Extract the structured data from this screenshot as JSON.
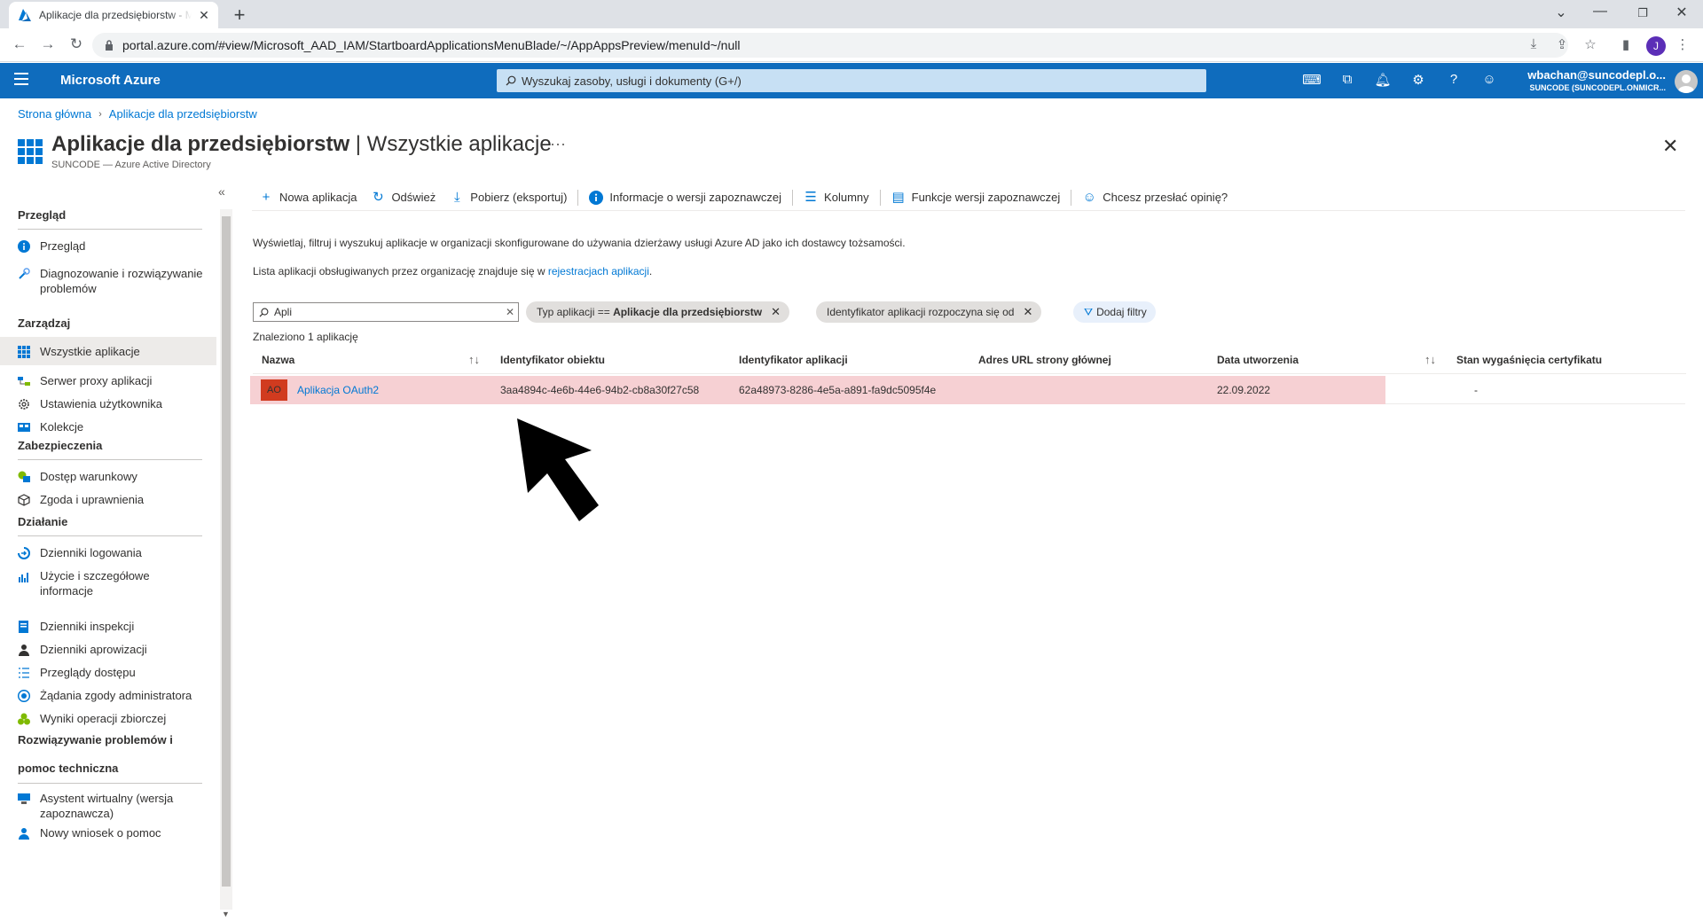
{
  "browser": {
    "tab_title": "Aplikacje dla przedsiębiorstw - Microsoft Azure",
    "url": "portal.azure.com/#view/Microsoft_AAD_IAM/StartboardApplicationsMenuBlade/~/AppAppsPreview/menuId~/null",
    "profile_initial": "J"
  },
  "azure": {
    "brand": "Microsoft Azure",
    "search_placeholder": "Wyszukaj zasoby, usługi i dokumenty (G+/)",
    "user_email": "wbachan@suncodepl.o...",
    "user_tenant": "SUNCODE (SUNCODEPL.ONMICR..."
  },
  "breadcrumb": {
    "home": "Strona główna",
    "current": "Aplikacje dla przedsiębiorstw"
  },
  "header": {
    "title_main": "Aplikacje dla przedsiębiorstw",
    "title_rest": " | Wszystkie aplikacje",
    "subtitle": "SUNCODE — Azure Active Directory",
    "more": "···"
  },
  "sidebar": {
    "sections": {
      "overview": "Przegląd",
      "manage": "Zarządzaj",
      "security": "Zabezpieczenia",
      "activity": "Działanie",
      "troubleshoot_1": "Rozwiązywanie problemów i",
      "troubleshoot_2": "pomoc techniczna"
    },
    "items": {
      "overview": "Przegląd",
      "diagnose": "Diagnozowanie i rozwiązywanie problemów",
      "all_apps": "Wszystkie aplikacje",
      "proxy": "Serwer proxy aplikacji",
      "user_settings": "Ustawienia użytkownika",
      "collections": "Kolekcje",
      "conditional_access": "Dostęp warunkowy",
      "consent": "Zgoda i uprawnienia",
      "signin_logs": "Dzienniki logowania",
      "usage": "Użycie i szczegółowe informacje",
      "audit_logs": "Dzienniki inspekcji",
      "provisioning_logs": "Dzienniki aprowizacji",
      "access_reviews": "Przeglądy dostępu",
      "admin_consent": "Żądania zgody administratora",
      "bulk_results": "Wyniki operacji zbiorczej",
      "virtual_assistant": "Asystent wirtualny (wersja zapoznawcza)",
      "new_support": "Nowy wniosek o pomoc"
    }
  },
  "commands": {
    "new_app": "Nowa aplikacja",
    "refresh": "Odśwież",
    "download": "Pobierz (eksportuj)",
    "preview_info": "Informacje o wersji zapoznawczej",
    "columns": "Kolumny",
    "preview_features": "Funkcje wersji zapoznawczej",
    "feedback": "Chcesz przesłać opinię?"
  },
  "description": {
    "line1": "Wyświetlaj, filtruj i wyszukuj aplikacje w organizacji skonfigurowane do używania dzierżawy usługi Azure AD jako ich dostawcy tożsamości.",
    "line2_prefix": "Lista aplikacji obsługiwanych przez organizację znajduje się w ",
    "line2_link": "rejestracjach aplikacji",
    "line2_suffix": "."
  },
  "filters": {
    "search_value": "Apli",
    "pill_type_prefix": "Typ aplikacji == ",
    "pill_type_value": "Aplikacje dla przedsiębiorstw",
    "pill_appid": "Identyfikator aplikacji rozpoczyna się od",
    "add_filters": "Dodaj filtry"
  },
  "results": {
    "found": "Znaleziono 1 aplikację"
  },
  "table": {
    "columns": {
      "name": "Nazwa",
      "object_id": "Identyfikator obiektu",
      "app_id": "Identyfikator aplikacji",
      "homepage": "Adres URL strony głównej",
      "created": "Data utworzenia",
      "cert_expiry": "Stan wygaśnięcia certyfikatu"
    },
    "rows": [
      {
        "badge": "AO",
        "name": "Aplikacja OAuth2",
        "object_id": "3aa4894c-4e6b-44e6-94b2-cb8a30f27c58",
        "app_id": "62a48973-8286-4e5a-a891-fa9dc5095f4e",
        "homepage": "",
        "created": "22.09.2022",
        "cert_expiry": "-"
      }
    ]
  },
  "colors": {
    "azure_blue": "#0f6cbd",
    "link": "#0078d4",
    "highlight": "#f6d0d3",
    "badge": "#d13b1f"
  }
}
